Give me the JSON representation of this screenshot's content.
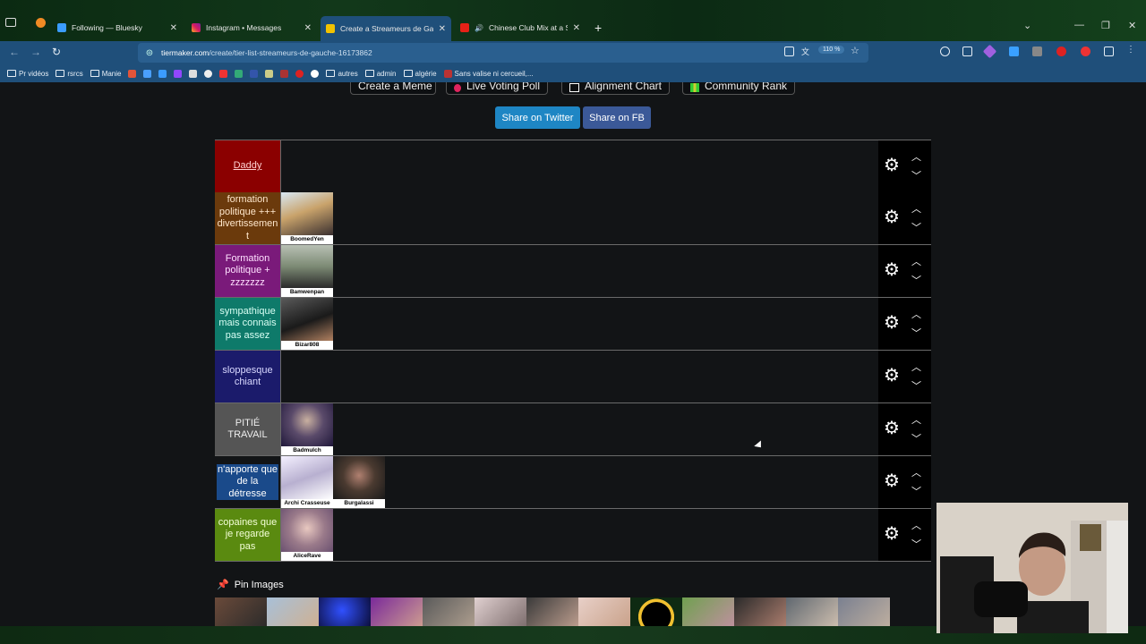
{
  "browser": {
    "tabs": [
      {
        "title": "Following — Bluesky",
        "active": false
      },
      {
        "title": "Instagram • Messages",
        "active": false
      },
      {
        "title": "Create a Streameurs de Gauche",
        "active": true
      },
      {
        "title": "Chinese Club Mix at a Senio",
        "active": false
      }
    ],
    "url_domain": "tiermaker.com",
    "url_path": "/create/tier-list-streameurs-de-gauche-16173862",
    "zoom": "110 %",
    "bookmarks": [
      "Pr vidéos",
      "rsrcs",
      "Manie",
      "autres",
      "admin",
      "algérie",
      "Sans valise ni cercueil,..."
    ]
  },
  "toolbar_buttons": [
    "Create a Meme",
    "Live Voting Poll",
    "Alignment Chart",
    "Community Rank"
  ],
  "share": {
    "twitter": "Share on Twitter",
    "facebook": "Share on FB"
  },
  "tiers": [
    {
      "label": "Daddy",
      "color": "#8b0000",
      "text_color": "#ffd0d0",
      "items": []
    },
    {
      "label": "formation politique +++ divertissement",
      "color": "#6b3a0c",
      "text_color": "#ffe7cc",
      "items": [
        {
          "caption": "BoomedYen"
        }
      ]
    },
    {
      "label": "Formation politique + zzzzzzz",
      "color": "#7a1a7a",
      "text_color": "#ffe0ff",
      "items": [
        {
          "caption": "Bamwenpan"
        }
      ]
    },
    {
      "label": "sympathique mais connais pas assez",
      "color": "#0e7a6a",
      "text_color": "#d8fff4",
      "items": [
        {
          "caption": "Bizar808"
        }
      ]
    },
    {
      "label": "sloppesque chiant",
      "color": "#1b1b6b",
      "text_color": "#d8d8ff",
      "items": []
    },
    {
      "label": "PITIÉ TRAVAIL",
      "color": "#555555",
      "text_color": "#eeeeee",
      "items": [
        {
          "caption": "Badmulch"
        }
      ]
    },
    {
      "label": "n'apporte que de la détresse",
      "color": "#1a4a8a",
      "text_color": "#ffffff",
      "items": [
        {
          "caption": "Archi Crasseuse"
        },
        {
          "caption": "Burgalassi"
        }
      ]
    },
    {
      "label": "copaines que je regarde pas",
      "color": "#5a8a10",
      "text_color": "#f4ffd8",
      "items": [
        {
          "caption": "AliceRave"
        }
      ]
    }
  ],
  "pin": {
    "title": "Pin Images"
  }
}
